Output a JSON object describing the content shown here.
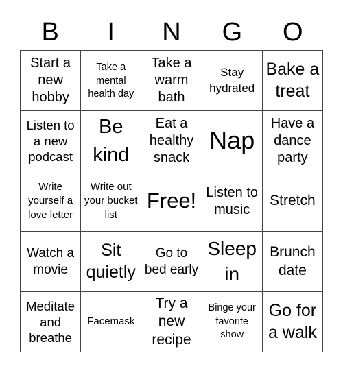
{
  "header": {
    "letters": [
      "B",
      "I",
      "N",
      "G",
      "O"
    ]
  },
  "cells": [
    "Start a new hobby",
    "Take a mental health day",
    "Take a warm bath",
    "Stay hydrated",
    "Bake a treat",
    "Listen to a new podcast",
    "Be kind",
    "Eat a healthy snack",
    "Nap",
    "Have a dance party",
    "Write yourself a love letter",
    "Write out your bucket list",
    "Free!",
    "Listen to music",
    "Stretch",
    "Watch a movie",
    "Sit quietly",
    "Go to bed early",
    "Sleep in",
    "Brunch date",
    "Meditate and breathe",
    "Facemask",
    "Try a new recipe",
    "Binge your favorite show",
    "Go for a walk"
  ]
}
